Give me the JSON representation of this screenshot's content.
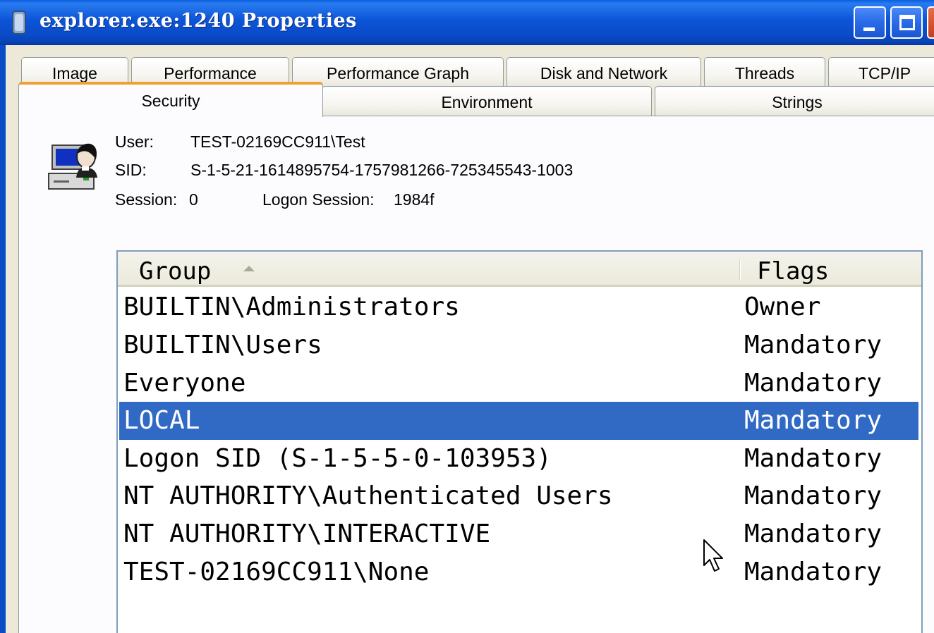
{
  "window": {
    "title": "explorer.exe:1240 Properties"
  },
  "tabs_row1": [
    {
      "label": "Image"
    },
    {
      "label": "Performance"
    },
    {
      "label": "Performance Graph"
    },
    {
      "label": "Disk and Network"
    },
    {
      "label": "Threads"
    },
    {
      "label": "TCP/IP"
    }
  ],
  "tabs_row2": [
    {
      "label": "Security",
      "active": true
    },
    {
      "label": "Environment"
    },
    {
      "label": "Strings"
    }
  ],
  "security": {
    "user_label": "User:",
    "user_value": "TEST-02169CC911\\Test",
    "sid_label": "SID:",
    "sid_value": "S-1-5-21-1614895754-1757981266-725345543-1003",
    "session_label": "Session:",
    "session_value": "0",
    "logon_session_label": "Logon Session:",
    "logon_session_value": "1984f"
  },
  "groups_table": {
    "columns": [
      "Group",
      "Flags"
    ],
    "sort_column": "Group",
    "sort_direction": "ascending",
    "rows": [
      {
        "group": "BUILTIN\\Administrators",
        "flags": "Owner"
      },
      {
        "group": "BUILTIN\\Users",
        "flags": "Mandatory"
      },
      {
        "group": "Everyone",
        "flags": "Mandatory"
      },
      {
        "group": "LOCAL",
        "flags": "Mandatory",
        "selected": true
      },
      {
        "group": "Logon SID (S-1-5-5-0-103953)",
        "flags": "Mandatory"
      },
      {
        "group": "NT AUTHORITY\\Authenticated Users",
        "flags": "Mandatory"
      },
      {
        "group": "NT AUTHORITY\\INTERACTIVE",
        "flags": "Mandatory"
      },
      {
        "group": "TEST-02169CC911\\None",
        "flags": "Mandatory"
      }
    ]
  },
  "colors": {
    "titlebar": "#0a4bc8",
    "selection": "#316ac5",
    "active_tab_accent": "#f0a030"
  },
  "icons": {
    "title": "process-icon",
    "user": "user-computer-icon",
    "cursor": "mouse-pointer-icon"
  }
}
